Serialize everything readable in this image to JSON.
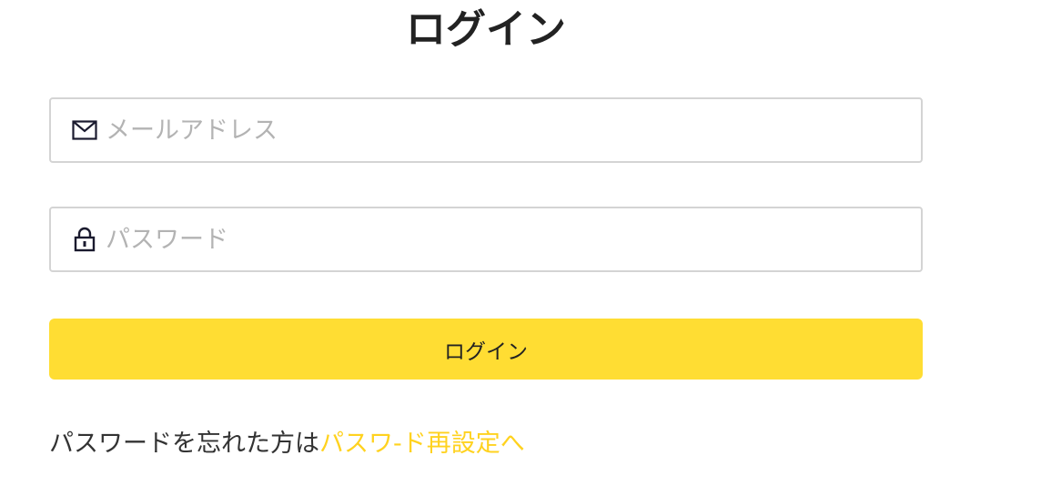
{
  "page": {
    "title": "ログイン"
  },
  "form": {
    "email": {
      "placeholder": "メールアドレス",
      "value": "",
      "icon": "envelope-icon"
    },
    "password": {
      "placeholder": "パスワード",
      "value": "",
      "icon": "lock-icon"
    },
    "submit_label": "ログイン"
  },
  "footer": {
    "forgot_text": "パスワードを忘れた方は",
    "reset_link_label": "パスワ-ド再設定へ"
  },
  "colors": {
    "accent": "#ffdd33",
    "link": "#ffd21f",
    "text": "#222222",
    "placeholder": "#b3b3b3",
    "border": "#d4d4d4"
  }
}
